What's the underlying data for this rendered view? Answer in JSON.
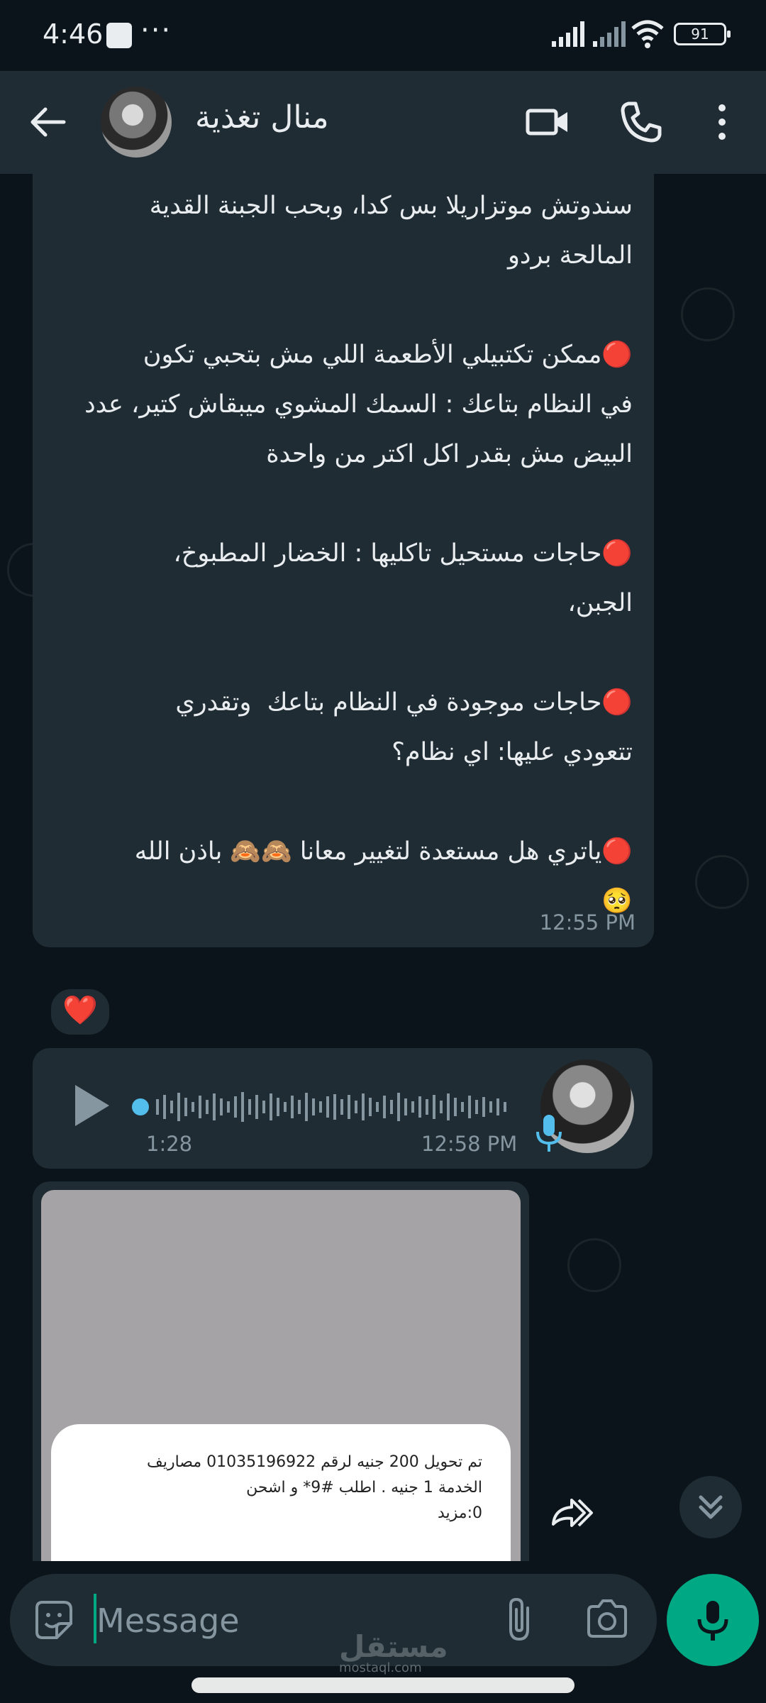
{
  "status_bar": {
    "time": "4:46",
    "battery": "91"
  },
  "header": {
    "contact_name": "منال تغذية"
  },
  "messages": {
    "text_message": {
      "text": "جبن غير موتزاريلا ودي مش اخضر والغدا والعشا\nسندوتش موتزاريلا بس كدا، وبحب الجبنة القدية\nالمالحة بردو\n\n🔴ممكن تكتبيلي الأطعمة اللي مش بتحبي تكون\nفي النظام بتاعك : السمك المشوي ميبقاش كتير، عدد\nالبيض مش بقدر اكل اكتر من واحدة\n\n🔴حاجات مستحيل تاكليها : الخضار المطبوخ،\nالجبن،\n\n🔴حاجات موجودة في النظام بتاعك  وتقدري\nتتعودي عليها: اي نظام؟\n\n🔴ياتري هل مستعدة لتغيير معانا 🙈🙈 باذن الله\n🥺",
      "time": "12:55 PM",
      "reaction": "❤️"
    },
    "voice_message": {
      "duration": "1:28",
      "time": "12:58 PM"
    },
    "image_message": {
      "card_text": "تم تحويل 200 جنيه لرقم 01035196922 مصاريف\nالخدمة 1 جنيه . اطلب #9* و اشحن\n0:مزيد"
    }
  },
  "composer": {
    "placeholder": "Message"
  },
  "watermark": {
    "text": "مستقل",
    "sub": "mostaql.com"
  },
  "icons": [
    "back-arrow-icon",
    "video-call-icon",
    "phone-icon",
    "more-options-icon",
    "play-icon",
    "mic-icon",
    "forward-icon",
    "chevron-double-down-icon",
    "sticker-icon",
    "attach-icon",
    "camera-icon"
  ],
  "colors": {
    "background": "#0b141a",
    "bubble": "#1f2c34",
    "accent": "#00a884",
    "muted": "#8696a0"
  }
}
